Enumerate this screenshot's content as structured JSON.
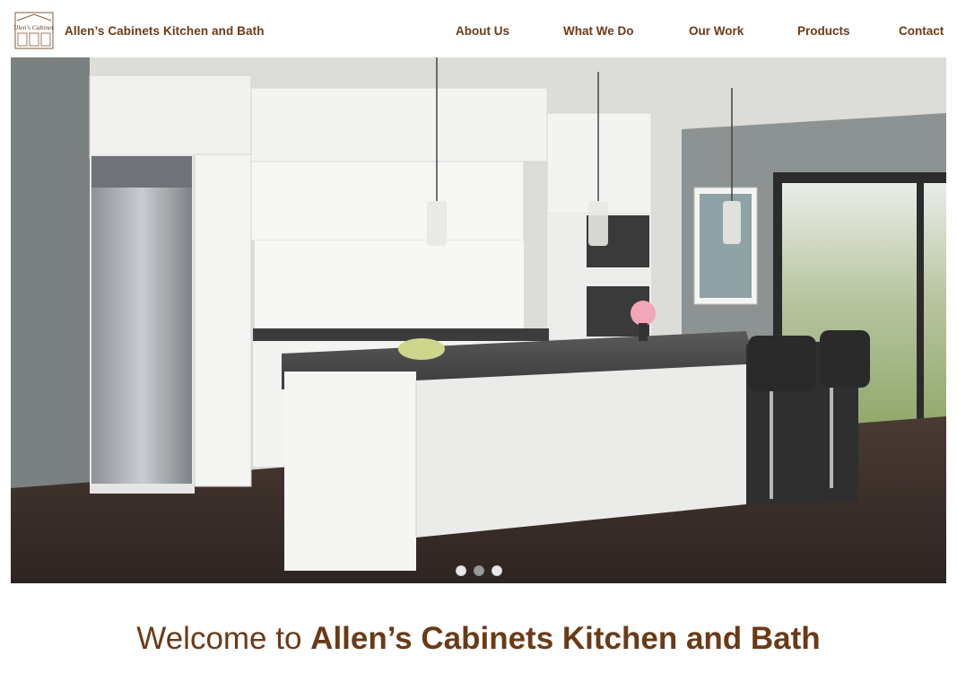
{
  "header": {
    "logo_text": "Allen's Cabinets",
    "site_name": "Allen’s Cabinets Kitchen and Bath"
  },
  "nav": {
    "items": [
      {
        "label": "About Us"
      },
      {
        "label": "What We Do"
      },
      {
        "label": "Our Work"
      },
      {
        "label": "Products"
      },
      {
        "label": "Contact"
      }
    ]
  },
  "hero": {
    "image": "kitchen-photo",
    "slide_count": 3,
    "active_slide": 2
  },
  "welcome": {
    "prefix": "Welcome to ",
    "name": "Allen’s Cabinets Kitchen and Bath"
  },
  "colors": {
    "brand_brown": "#6b3a17",
    "background": "#ffffff"
  }
}
